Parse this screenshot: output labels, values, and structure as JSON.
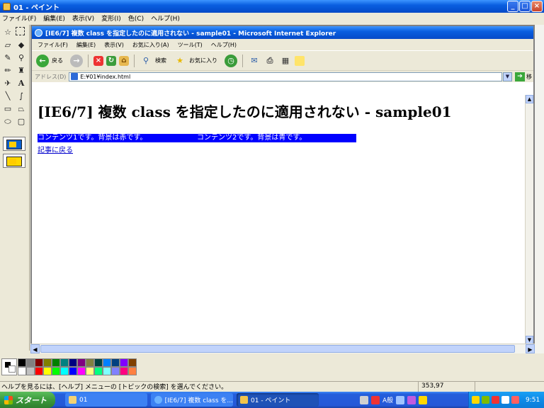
{
  "paint": {
    "title": "01 - ペイント",
    "menu": [
      "ファイル(F)",
      "編集(E)",
      "表示(V)",
      "変形(I)",
      "色(C)",
      "ヘルプ(H)"
    ],
    "status_help": "ヘルプを見るには、[ヘルプ] メニューの [トピックの検索] を選んでください。",
    "coords": "353,97",
    "palette_colors": [
      "#000000",
      "#808080",
      "#800000",
      "#808000",
      "#008000",
      "#008080",
      "#000080",
      "#800080",
      "#808040",
      "#004040",
      "#0080ff",
      "#004080",
      "#8000ff",
      "#804000",
      "#ffffff",
      "#c0c0c0",
      "#ff0000",
      "#ffff00",
      "#00ff00",
      "#00ffff",
      "#0000ff",
      "#ff00ff",
      "#ffff80",
      "#00ff80",
      "#80ffff",
      "#8080ff",
      "#ff0080",
      "#ff8040"
    ]
  },
  "ie": {
    "title": "[IE6/7] 複数 class を指定したのに適用されない - sample01 - Microsoft Internet Explorer",
    "menu": [
      "ファイル(F)",
      "編集(E)",
      "表示(V)",
      "お気に入り(A)",
      "ツール(T)",
      "ヘルプ(H)"
    ],
    "toolbar": {
      "back": "戻る",
      "search": "検索",
      "favorites": "お気に入り"
    },
    "address_label": "アドレス(D)",
    "address": "E:¥01¥index.html",
    "go_label": "移",
    "heading": "[IE6/7] 複数 class を指定したのに適用されない - sample01",
    "content1": "コンテンツ1です。背景は赤です。",
    "content2": "コンテンツ2です。背景は青です。",
    "back_link": "記事に戻る"
  },
  "taskbar": {
    "start": "スタート",
    "tasks": [
      "01",
      "[IE6/7] 複数 class を...",
      "01 - ペイント"
    ],
    "lang": "A般",
    "clock": "9:51"
  }
}
